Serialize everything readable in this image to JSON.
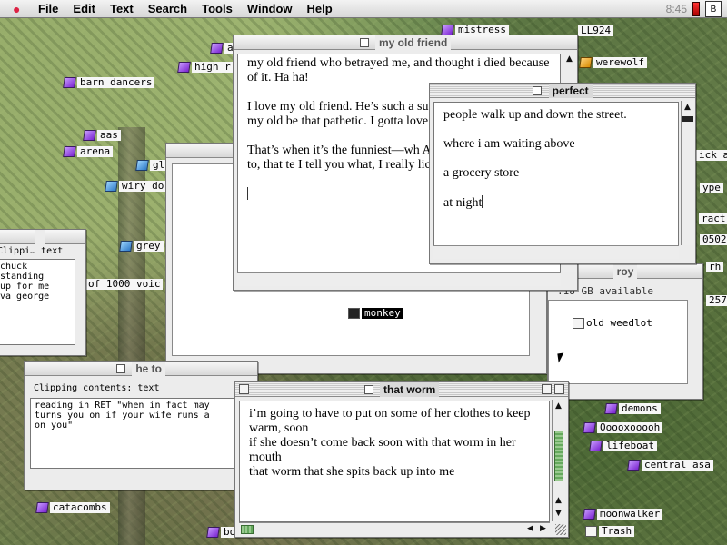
{
  "menubar": {
    "apple_label": "",
    "items": [
      "File",
      "Edit",
      "Text",
      "Search",
      "Tools",
      "Window",
      "Help"
    ],
    "clock": "8:45",
    "app_badge": "B"
  },
  "desktop": {
    "icons": [
      {
        "label": "barn dancers",
        "type": "folder",
        "color": "purple"
      },
      {
        "label": "aas",
        "type": "folder",
        "color": "purple"
      },
      {
        "label": "arena",
        "type": "folder",
        "color": "purple"
      },
      {
        "label": "gl",
        "type": "folder",
        "color": "blue"
      },
      {
        "label": "wiry do",
        "type": "folder",
        "color": "blue"
      },
      {
        "label": "grey",
        "type": "folder",
        "color": "blue"
      },
      {
        "label": "of 1000 voic",
        "type": "text",
        "color": ""
      },
      {
        "label": "catacombs",
        "type": "folder",
        "color": "purple"
      },
      {
        "label": "bo",
        "type": "folder",
        "color": "purple"
      },
      {
        "label": "high r",
        "type": "folder",
        "color": "purple"
      },
      {
        "label": "a",
        "type": "folder",
        "color": "purple"
      },
      {
        "label": "mistress",
        "type": "folder",
        "color": "purple"
      },
      {
        "label": "LL924",
        "type": "text",
        "color": ""
      },
      {
        "label": "werewolf",
        "type": "folder",
        "color": "orange"
      },
      {
        "label": "ick a",
        "type": "text",
        "color": ""
      },
      {
        "label": "ype",
        "type": "text",
        "color": ""
      },
      {
        "label": "ract",
        "type": "text",
        "color": ""
      },
      {
        "label": "0502",
        "type": "text",
        "color": ""
      },
      {
        "label": "rh",
        "type": "text",
        "color": ""
      },
      {
        "label": "257",
        "type": "text",
        "color": ""
      },
      {
        "label": "demons",
        "type": "folder",
        "color": "purple"
      },
      {
        "label": "Ooooxooooh",
        "type": "folder",
        "color": "purple"
      },
      {
        "label": "lifeboat",
        "type": "folder",
        "color": "purple"
      },
      {
        "label": "central asa",
        "type": "folder",
        "color": "purple"
      },
      {
        "label": "moonwalker",
        "type": "folder",
        "color": "purple"
      },
      {
        "label": "Trash",
        "type": "trash",
        "color": ""
      },
      {
        "label": "monkey",
        "type": "selected",
        "color": ""
      }
    ]
  },
  "windows": {
    "my_old_friend": {
      "title": "my old friend",
      "paragraphs": [
        "my old friend who betrayed me, and thought i died because of it. Ha ha!",
        "I love my old friend. He’s such a such a dupe! Nobody but my old be that pathetic. I gotta love him when I’m drunk.",
        "That’s when it’s the funniest—wh And how he begged me to, that te I tell you what, I really licked his good!"
      ]
    },
    "perfect": {
      "title": "perfect",
      "lines": [
        "people walk up and down the street.",
        "where i am waiting above",
        "a grocery store",
        "at night"
      ]
    },
    "that_worm": {
      "title": "that worm",
      "lines": [
        "i’m going to have to put on some of her clothes to keep warm, soon",
        "if she doesn’t come back soon with that worm in her mouth",
        "that worm that she spits back up into me"
      ]
    },
    "clipping_left": {
      "title": "Clippi… text",
      "content": "chuck\nstanding\nup for me\nva george"
    },
    "clipping_he": {
      "title": "he to",
      "heading": "Clipping contents: text",
      "content": "reading in RET \"when in fact may\nturns you on if your wife runs a\non you\""
    },
    "roy": {
      "title": "roy",
      "info": ".18 GB available",
      "item": "old weedlot"
    },
    "empty_window": {
      "title": ""
    }
  }
}
